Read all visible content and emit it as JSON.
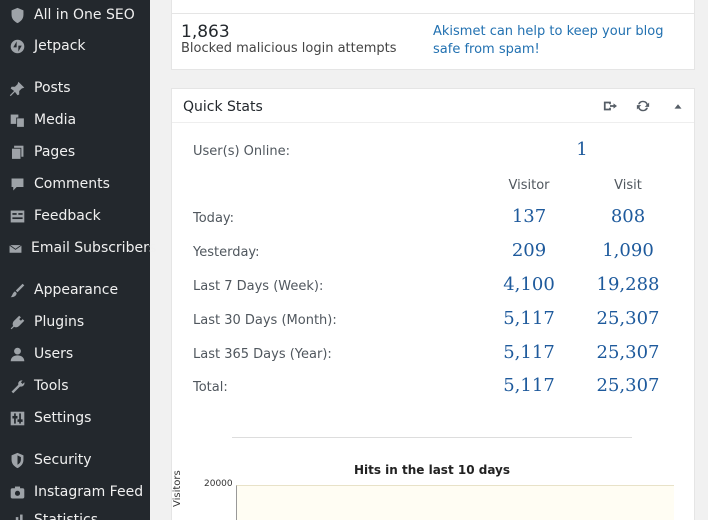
{
  "sidebar": {
    "items": [
      {
        "label": "All in One SEO",
        "icon": "shield-icon"
      },
      {
        "label": "Jetpack",
        "icon": "jetpack-icon"
      },
      {
        "label": "Posts",
        "icon": "pin-icon"
      },
      {
        "label": "Media",
        "icon": "media-icon"
      },
      {
        "label": "Pages",
        "icon": "pages-icon"
      },
      {
        "label": "Comments",
        "icon": "comment-icon"
      },
      {
        "label": "Feedback",
        "icon": "feedback-icon"
      },
      {
        "label": "Email Subscribers",
        "icon": "email-icon"
      },
      {
        "label": "Appearance",
        "icon": "brush-icon"
      },
      {
        "label": "Plugins",
        "icon": "plugin-icon"
      },
      {
        "label": "Users",
        "icon": "user-icon"
      },
      {
        "label": "Tools",
        "icon": "wrench-icon"
      },
      {
        "label": "Settings",
        "icon": "settings-icon"
      },
      {
        "label": "Security",
        "icon": "security-shield-icon"
      },
      {
        "label": "Instagram Feed",
        "icon": "camera-icon"
      },
      {
        "label": "Statistics",
        "icon": "stats-icon"
      }
    ]
  },
  "akismet": {
    "blocked_count": "1,863",
    "blocked_label": "Blocked malicious login attempts",
    "link_text": "Akismet can help to keep your blog safe from spam!"
  },
  "quick_stats": {
    "title": "Quick Stats",
    "online_label": "User(s) Online:",
    "online_value": "1",
    "col_visitor": "Visitor",
    "col_visit": "Visit",
    "rows": [
      {
        "label": "Today:",
        "visitor": "137",
        "visit": "808"
      },
      {
        "label": "Yesterday:",
        "visitor": "209",
        "visit": "1,090"
      },
      {
        "label": "Last 7 Days (Week):",
        "visitor": "4,100",
        "visit": "19,288"
      },
      {
        "label": "Last 30 Days (Month):",
        "visitor": "5,117",
        "visit": "25,307"
      },
      {
        "label": "Last 365 Days (Year):",
        "visitor": "5,117",
        "visit": "25,307"
      },
      {
        "label": "Total:",
        "visitor": "5,117",
        "visit": "25,307"
      }
    ]
  },
  "chart": {
    "title": "Hits in the last 10 days",
    "y_tick_top": "20000",
    "y_label": "Visitors"
  }
}
